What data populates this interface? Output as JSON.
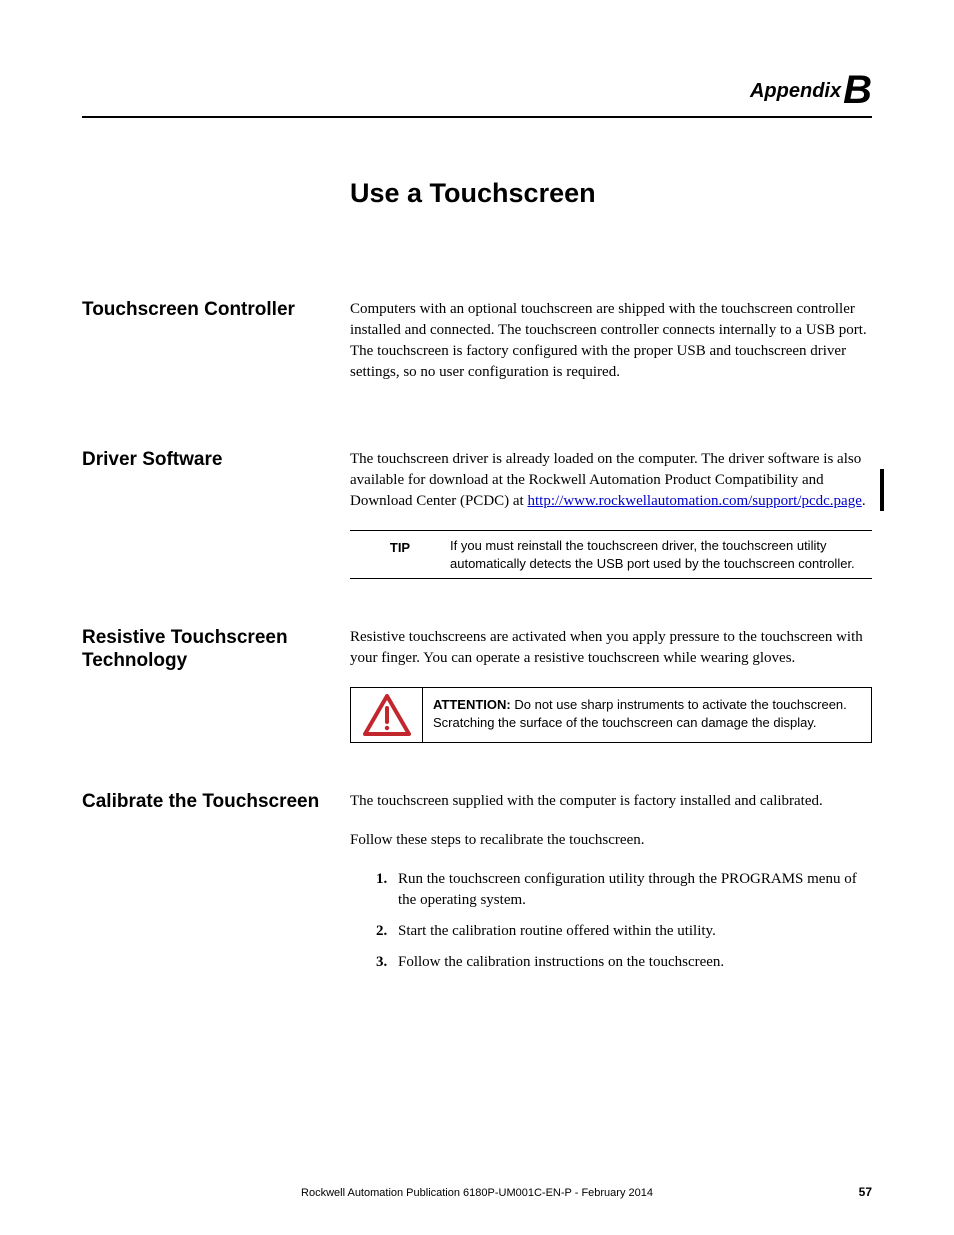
{
  "header": {
    "appendix_word": "Appendix",
    "appendix_letter": "B"
  },
  "chapter_title": "Use a Touchscreen",
  "sections": {
    "controller": {
      "heading": "Touchscreen Controller",
      "body": "Computers with an optional touchscreen are shipped with the touchscreen controller installed and connected. The touchscreen controller connects internally to a USB port. The touchscreen is factory configured with the proper USB and touchscreen driver settings, so no user configuration is required."
    },
    "driver": {
      "heading": "Driver Software",
      "body_pre": "The touchscreen driver is already loaded on the computer. The driver software is also available for download at the Rockwell Automation Product Compatibility and Download Center (PCDC) at ",
      "link_text": "http://www.rockwellautomation.com/support/pcdc.page",
      "body_post": ".",
      "tip_label": "TIP",
      "tip_text": "If you must reinstall the touchscreen driver, the touchscreen utility automatically detects the USB port used by the touchscreen controller."
    },
    "resistive": {
      "heading": "Resistive Touchscreen Technology",
      "body": "Resistive touchscreens are activated when you apply pressure to the touchscreen with your finger. You can operate a resistive touchscreen while wearing gloves.",
      "attention_label": "ATTENTION:",
      "attention_text": " Do not use sharp instruments to activate the touchscreen. Scratching the surface of the touchscreen can damage the display."
    },
    "calibrate": {
      "heading": "Calibrate the Touchscreen",
      "intro1": "The touchscreen supplied with the computer is factory installed and calibrated.",
      "intro2": "Follow these steps to recalibrate the touchscreen.",
      "steps": [
        "Run the touchscreen configuration utility through the PROGRAMS menu of the operating system.",
        "Start the calibration routine offered within the utility.",
        "Follow the calibration instructions on the touchscreen."
      ]
    }
  },
  "footer": {
    "publication": "Rockwell Automation Publication 6180P-UM001C-EN-P - February 2014",
    "page": "57"
  }
}
